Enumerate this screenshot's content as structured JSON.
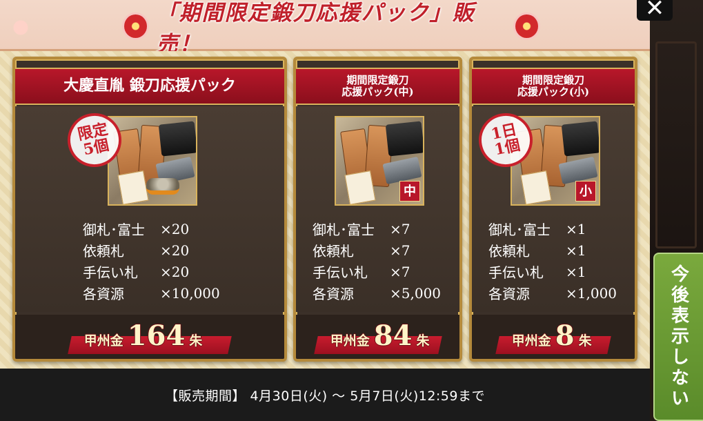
{
  "window": {
    "close_label": "✕"
  },
  "header": {
    "title": "「期間限定鍛刀応援パック」販売！"
  },
  "packs": [
    {
      "title": "大慶直胤 鍛刀応援パック",
      "stamp": "限定\n5個",
      "size_badge": "",
      "items": [
        {
          "name": "御札･富士",
          "qty": "×20"
        },
        {
          "name": "依頼札",
          "qty": "×20"
        },
        {
          "name": "手伝い札",
          "qty": "×20"
        },
        {
          "name": "各資源",
          "qty": "×10,000"
        }
      ],
      "price": {
        "prefix": "甲州金",
        "value": "164",
        "unit": "朱"
      }
    },
    {
      "title": "期間限定鍛刀\n応援パック(中)",
      "stamp": "",
      "size_badge": "中",
      "items": [
        {
          "name": "御札･富士",
          "qty": "×7"
        },
        {
          "name": "依頼札",
          "qty": "×7"
        },
        {
          "name": "手伝い札",
          "qty": "×7"
        },
        {
          "name": "各資源",
          "qty": "×5,000"
        }
      ],
      "price": {
        "prefix": "甲州金",
        "value": "84",
        "unit": "朱"
      }
    },
    {
      "title": "期間限定鍛刀\n応援パック(小)",
      "stamp": "1日\n1個",
      "size_badge": "小",
      "items": [
        {
          "name": "御札･富士",
          "qty": "×1"
        },
        {
          "name": "依頼札",
          "qty": "×1"
        },
        {
          "name": "手伝い札",
          "qty": "×1"
        },
        {
          "name": "各資源",
          "qty": "×1,000"
        }
      ],
      "price": {
        "prefix": "甲州金",
        "value": "8",
        "unit": "朱"
      }
    }
  ],
  "footer": {
    "sale_period": "【販売期間】 4月30日(火) 〜 5月7日(火)12:59まで"
  },
  "side_button": {
    "label": "今後表示しない"
  },
  "colors": {
    "header_bg": "#f3d8c9",
    "title_red": "#c0202a",
    "card_red": "#b8172a",
    "card_dark": "#3b3029",
    "gold_border": "#d9b35c",
    "side_green": "#6a9a33",
    "footer_bg": "#1b1b1b"
  }
}
